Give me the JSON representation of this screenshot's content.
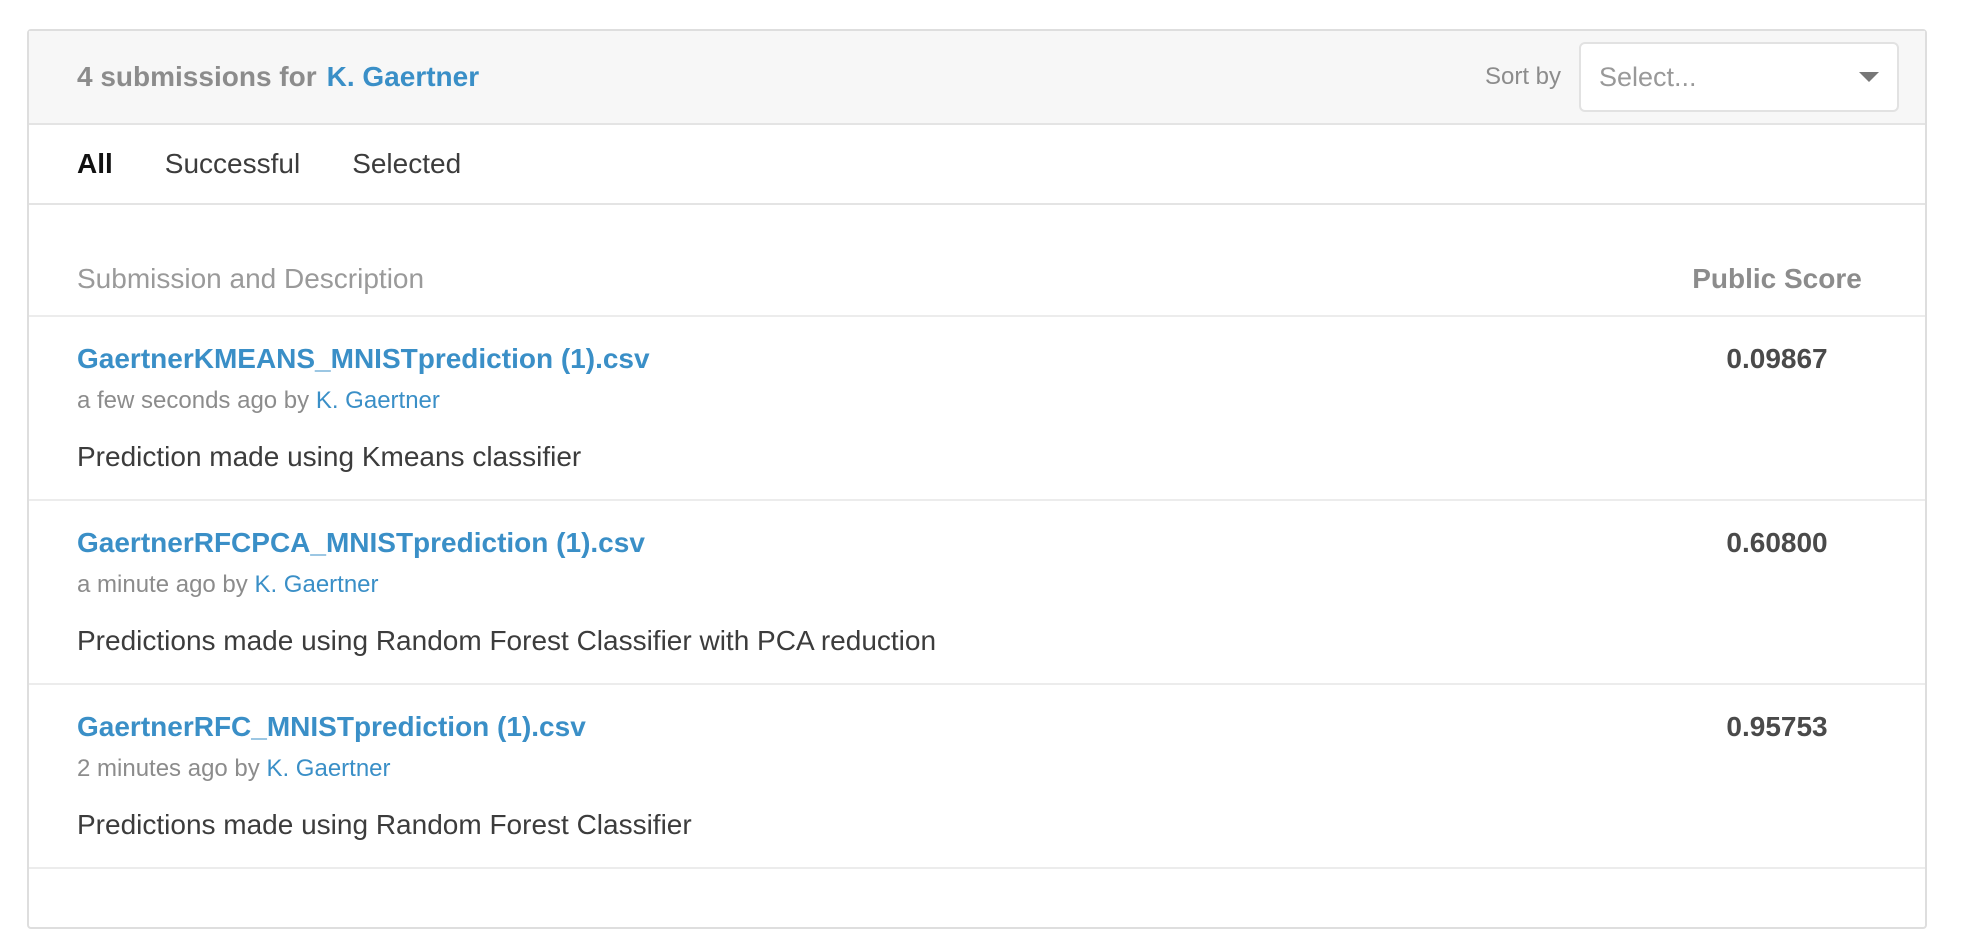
{
  "header": {
    "title_prefix": "4 submissions for",
    "owner": "K. Gaertner",
    "sort_label": "Sort by",
    "sort_placeholder": "Select..."
  },
  "tabs": [
    {
      "label": "All",
      "active": true
    },
    {
      "label": "Successful",
      "active": false
    },
    {
      "label": "Selected",
      "active": false
    }
  ],
  "table": {
    "col_submission": "Submission and Description",
    "col_score": "Public Score",
    "rows": [
      {
        "file": "GaertnerKMEANS_MNISTprediction (1).csv",
        "time": "a few seconds ago by",
        "author": "K. Gaertner",
        "description": "Prediction made using Kmeans classifier",
        "score": "0.09867"
      },
      {
        "file": "GaertnerRFCPCA_MNISTprediction (1).csv",
        "time": "a minute ago by",
        "author": "K. Gaertner",
        "description": "Predictions made using Random Forest Classifier with PCA reduction",
        "score": "0.60800"
      },
      {
        "file": "GaertnerRFC_MNISTprediction (1).csv",
        "time": "2 minutes ago by",
        "author": "K. Gaertner",
        "description": "Predictions made using Random Forest Classifier",
        "score": "0.95753"
      }
    ]
  },
  "colors": {
    "link": "#3a8fc7",
    "header_bg": "#f7f7f7",
    "border": "#dedede"
  }
}
